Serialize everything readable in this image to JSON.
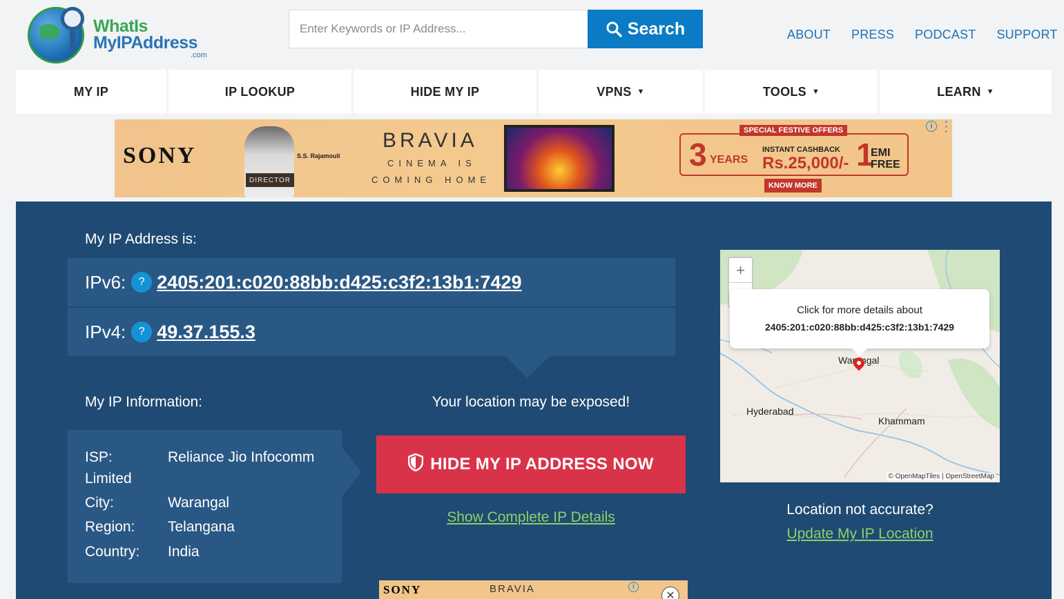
{
  "logo": {
    "line1": "WhatIs",
    "line2": "MyIPAddress",
    "line3": ".com"
  },
  "search": {
    "placeholder": "Enter Keywords or IP Address...",
    "button_label": "Search"
  },
  "topnav": [
    "ABOUT",
    "PRESS",
    "PODCAST",
    "SUPPORT"
  ],
  "mainnav": [
    {
      "label": "MY IP",
      "dropdown": false
    },
    {
      "label": "IP LOOKUP",
      "dropdown": false
    },
    {
      "label": "HIDE MY IP",
      "dropdown": false
    },
    {
      "label": "VPNS",
      "dropdown": true
    },
    {
      "label": "TOOLS",
      "dropdown": true
    },
    {
      "label": "LEARN",
      "dropdown": true
    }
  ],
  "ad": {
    "brand": "SONY",
    "person_name": "S.S. Rajamouli",
    "chair_label": "DIRECTOR",
    "product": "BRAVIA",
    "tagline1": "CINEMA IS",
    "tagline2": "COMING HOME",
    "offer_header": "SPECIAL FESTIVE OFFERS",
    "warranty_num": "3",
    "warranty_text": "YEARS",
    "cashback_label": "INSTANT CASHBACK",
    "cashback_amount": "Rs.25,000/-",
    "emi_num": "1",
    "emi_text1": "EMI",
    "emi_text2": "FREE",
    "cta": "KNOW MORE"
  },
  "ip": {
    "heading": "My IP Address is:",
    "ipv6_label": "IPv6:",
    "ipv6": "2405:201:c020:88bb:d425:c3f2:13b1:7429",
    "ipv4_label": "IPv4:",
    "ipv4": "49.37.155.3",
    "help_glyph": "?"
  },
  "info": {
    "heading": "My IP Information:",
    "isp_label": "ISP:",
    "isp_value": "Reliance Jio Infocomm",
    "isp_cont": "Limited",
    "city_label": "City:",
    "city_value": "Warangal",
    "region_label": "Region:",
    "region_value": "Telangana",
    "country_label": "Country:",
    "country_value": "India"
  },
  "exposure": {
    "message": "Your location may be exposed!",
    "button_label": "HIDE MY IP ADDRESS NOW",
    "details_link": "Show Complete IP Details"
  },
  "map": {
    "popup_line1": "Click for more details about",
    "popup_line2": "2405:201:c020:88bb:d425:c3f2:13b1:7429",
    "cities": [
      "Warangal",
      "Hyderabad",
      "Khammam"
    ],
    "attribution": "© OpenMapTiles | OpenStreetMap",
    "zoom_in": "+",
    "zoom_out": "−"
  },
  "location": {
    "question": "Location not accurate?",
    "update_link": "Update My IP Location"
  },
  "ad2": {
    "brand": "SONY",
    "product": "BRAVIA"
  },
  "colors": {
    "brand_blue": "#0a7bc4",
    "panel": "#1f4a73",
    "panel_light": "#2a5885",
    "cta_red": "#d9334a",
    "link_green": "#8bd26a"
  }
}
